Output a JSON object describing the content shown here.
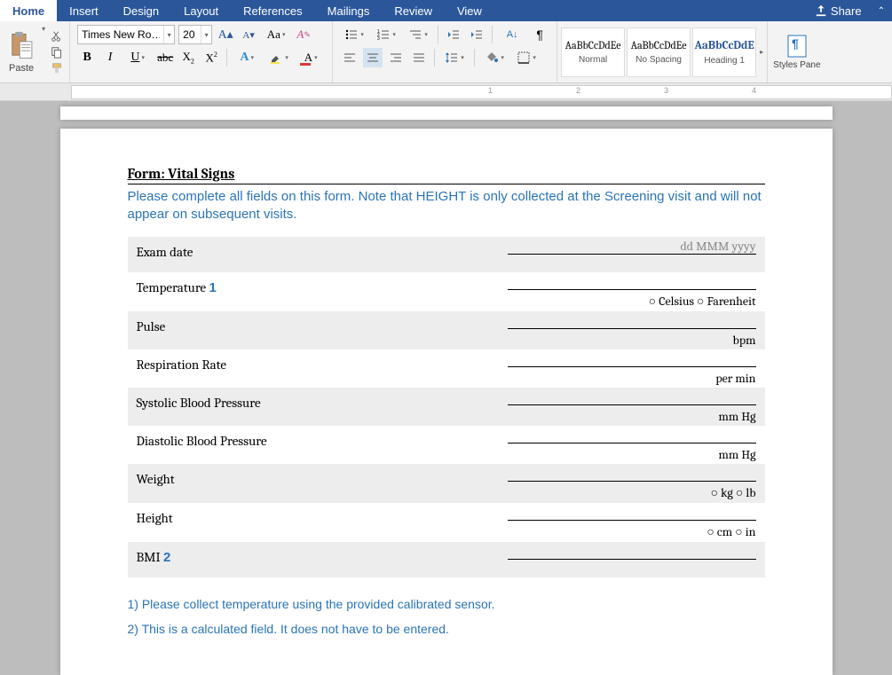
{
  "tabs": [
    "Home",
    "Insert",
    "Design",
    "Layout",
    "References",
    "Mailings",
    "Review",
    "View"
  ],
  "active_tab": 0,
  "share_label": "Share",
  "paste_label": "Paste",
  "font_name": "Times New Ro…",
  "font_size": "20",
  "styles": [
    {
      "sample": "AaBbCcDdEe",
      "name": "Normal",
      "kind": "n"
    },
    {
      "sample": "AaBbCcDdEe",
      "name": "No Spacing",
      "kind": "n"
    },
    {
      "sample": "AaBbCcDdE",
      "name": "Heading 1",
      "kind": "h1"
    }
  ],
  "styles_pane_label": "Styles Pane",
  "ruler_marks": [
    "1",
    "2",
    "3",
    "4"
  ],
  "doc": {
    "title": "Form: Vital Signs",
    "instructions": "Please complete all fields on this form. Note that HEIGHT is only collected at the Screening visit and will not appear on subsequent visits.",
    "rows": [
      {
        "label": "Exam date",
        "sup": "",
        "placeholder": "dd MMM yyyy",
        "unit": "",
        "alt": true
      },
      {
        "label": "Temperature",
        "sup": "1",
        "placeholder": "",
        "unit": "○ Celsius ○ Farenheit",
        "alt": false
      },
      {
        "label": "Pulse",
        "sup": "",
        "placeholder": "",
        "unit": "bpm",
        "alt": true
      },
      {
        "label": "Respiration Rate",
        "sup": "",
        "placeholder": "",
        "unit": "per min",
        "alt": false
      },
      {
        "label": "Systolic Blood Pressure",
        "sup": "",
        "placeholder": "",
        "unit": "mm Hg",
        "alt": true
      },
      {
        "label": "Diastolic Blood Pressure",
        "sup": "",
        "placeholder": "",
        "unit": "mm Hg",
        "alt": false
      },
      {
        "label": "Weight",
        "sup": "",
        "placeholder": "",
        "unit": "○ kg ○ lb",
        "alt": true
      },
      {
        "label": "Height",
        "sup": "",
        "placeholder": "",
        "unit": "○ cm ○ in",
        "alt": false
      },
      {
        "label": "BMI",
        "sup": "2",
        "placeholder": "",
        "unit": "",
        "alt": true
      }
    ],
    "notes": [
      "1) Please collect temperature using the provided calibrated sensor.",
      "2) This is a calculated field. It does not have to be entered."
    ]
  }
}
